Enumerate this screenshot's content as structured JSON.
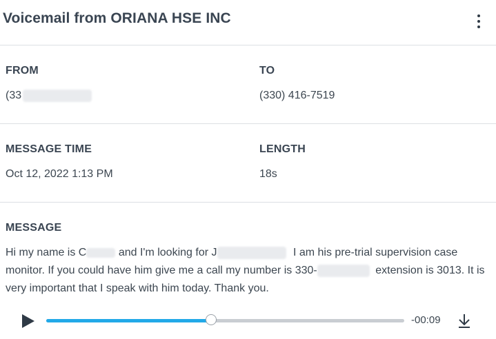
{
  "header": {
    "title": "Voicemail from ORIANA HSE INC",
    "menu_icon": "more-vertical-icon"
  },
  "from": {
    "label": "FROM",
    "value_visible": "(33"
  },
  "to": {
    "label": "TO",
    "value": "(330) 416-7519"
  },
  "message_time": {
    "label": "MESSAGE TIME",
    "value": "Oct 12, 2022 1:13 PM"
  },
  "length": {
    "label": "LENGTH",
    "value": "18s"
  },
  "message": {
    "label": "MESSAGE",
    "part1": "Hi my name is C",
    "part2": "and I'm looking for J",
    "part3": "I am his pre-trial supervision case monitor. If you could have him give me a call my number is 330-",
    "part4": "extension is 3013. It is very important that I speak with him today. Thank you."
  },
  "player": {
    "play_icon": "play-icon",
    "download_icon": "download-icon",
    "remaining_time": "-00:09",
    "progress": 0.46,
    "accent_color": "#22a9e8"
  }
}
